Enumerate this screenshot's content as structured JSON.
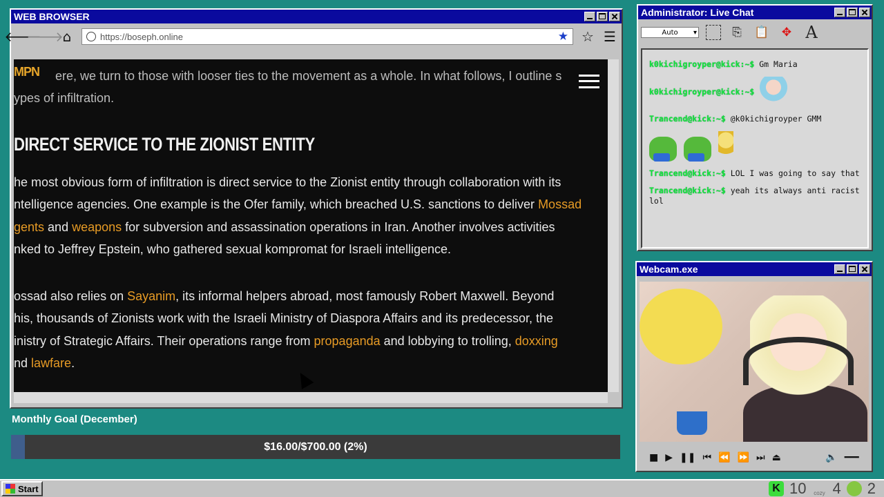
{
  "browser": {
    "title": "WEB BROWSER",
    "url": "https://boseph.online"
  },
  "page": {
    "logo_text": "MPN",
    "intro_line1": "ere, we turn to those with looser ties to the movement as a whole. In what follows, I outline s",
    "intro_line2": "ypes of infiltration.",
    "heading": "DIRECT SERVICE TO THE ZIONIST ENTITY",
    "p1_l1": "he most obvious form of infiltration is direct service to the Zionist entity through collaboration with its",
    "p1_l2a": "ntelligence agencies. One example is the Ofer family, which breached U.S. sanctions to deliver ",
    "p1_l2_link": "Mossad",
    "p1_l3_link1": "gents",
    "p1_l3a": " and ",
    "p1_l3_link2": "weapons",
    "p1_l3b": " for subversion and assassination operations in Iran. Another involves activities",
    "p1_l4": "nked to Jeffrey Epstein, who gathered sexual kompromat for Israeli intelligence.",
    "p2_l1a": "ossad also relies on ",
    "p2_l1_link": "Sayanim",
    "p2_l1b": ", its informal helpers abroad, most famously Robert Maxwell. Beyond",
    "p2_l2": "his, thousands of Zionists work with the Israeli Ministry of Diaspora Affairs and its predecessor, the",
    "p2_l3a": "inistry of Strategic Affairs. Their operations range from ",
    "p2_l3_link1": "propaganda",
    "p2_l3b": " and lobbying to trolling, ",
    "p2_l3_link2": "doxxing",
    "p2_l4a": "nd ",
    "p2_l4_link": "lawfare",
    "p2_l4b": "."
  },
  "goal": {
    "label": "Monthly Goal (December)",
    "text": "$16.00/$700.00 (2%)",
    "fraction": 0.023
  },
  "chat": {
    "title": "Administrator: Live Chat",
    "auto_label": "Auto",
    "messages": [
      {
        "user": "k0kichigroyper@kick:~$",
        "text": " Gm Maria"
      },
      {
        "user": "k0kichigroyper@kick:~$",
        "text": ""
      },
      {
        "user": "Trancend@kick:~$",
        "text": " @k0kichigroyper GMM"
      },
      {
        "user": "Trancend@kick:~$",
        "text": " LOL I was going to say that"
      },
      {
        "user": "Trancend@kick:~$",
        "text": " yeah its always anti racist lol"
      }
    ]
  },
  "webcam": {
    "title": "Webcam.exe"
  },
  "taskbar": {
    "start_label": "Start",
    "kick_count": "10",
    "rumble_count": "4",
    "other_count": "2",
    "cozy_label": "cozy"
  },
  "colors": {
    "titlebar": "#0a0a9e",
    "desktop": "#1c8a82",
    "link": "#e79b25",
    "chat_user": "#14e63c"
  }
}
